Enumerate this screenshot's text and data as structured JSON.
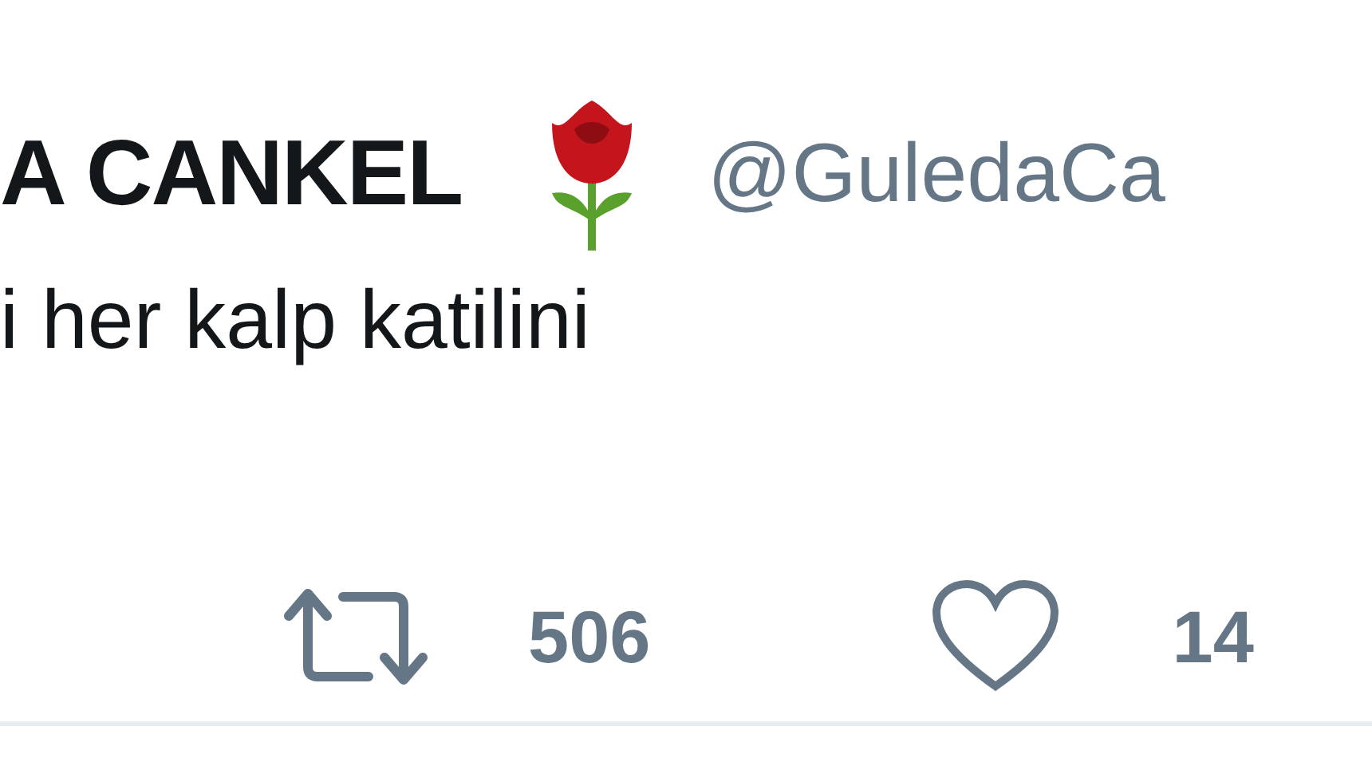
{
  "tweet": {
    "author_name": "A CANKEL",
    "handle": "@GuledaCa",
    "text": "i her kalp katilini",
    "actions": [
      {
        "kind": "retweet",
        "count": "506"
      },
      {
        "kind": "like",
        "count": "14"
      }
    ]
  }
}
